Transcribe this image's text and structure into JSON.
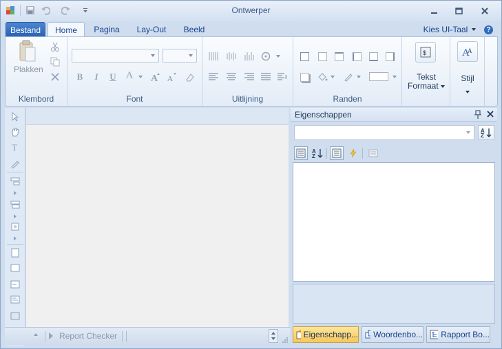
{
  "window": {
    "title": "Ontwerper",
    "icons": [
      "app-icon",
      "save-icon",
      "undo-icon",
      "redo-icon",
      "customize-qat-icon"
    ],
    "controls": [
      "minimize-icon",
      "restore-icon",
      "close-icon"
    ]
  },
  "tabs": {
    "file": "Bestand",
    "home": "Home",
    "page": "Pagina",
    "layout": "Lay-Out",
    "view": "Beeld",
    "ui_language": "Kies UI-Taal",
    "help": "?"
  },
  "ribbon": {
    "clipboard": {
      "label": "Klembord",
      "paste": "Plakken"
    },
    "font": {
      "label": "Font",
      "font_name": "",
      "font_size": "",
      "bold": "B",
      "italic": "I",
      "underline": "U",
      "font_color": "A"
    },
    "alignment": {
      "label": "Uitlijning"
    },
    "borders": {
      "label": "Randen"
    },
    "text_format": {
      "label_line1": "Tekst",
      "label_line2": "Formaat"
    },
    "style": {
      "label": "Stijl"
    }
  },
  "bottom_bar": {
    "report_checker": "Report Checker"
  },
  "properties_panel": {
    "title": "Eigenschappen",
    "pin": " 1",
    "close": "✕",
    "object_selector": "",
    "tabs": [
      {
        "label": "Eigenschapp...",
        "icon": "properties-icon",
        "active": true
      },
      {
        "label": "Woordenbo...",
        "icon": "dictionary-icon",
        "active": false
      },
      {
        "label": "Rapport Bo...",
        "icon": "report-tree-icon",
        "active": false
      }
    ]
  },
  "colors": {
    "accent": "#2a62b4",
    "ribbon_bg": "#e3ecf7",
    "active_tab": "#f8c75a"
  }
}
